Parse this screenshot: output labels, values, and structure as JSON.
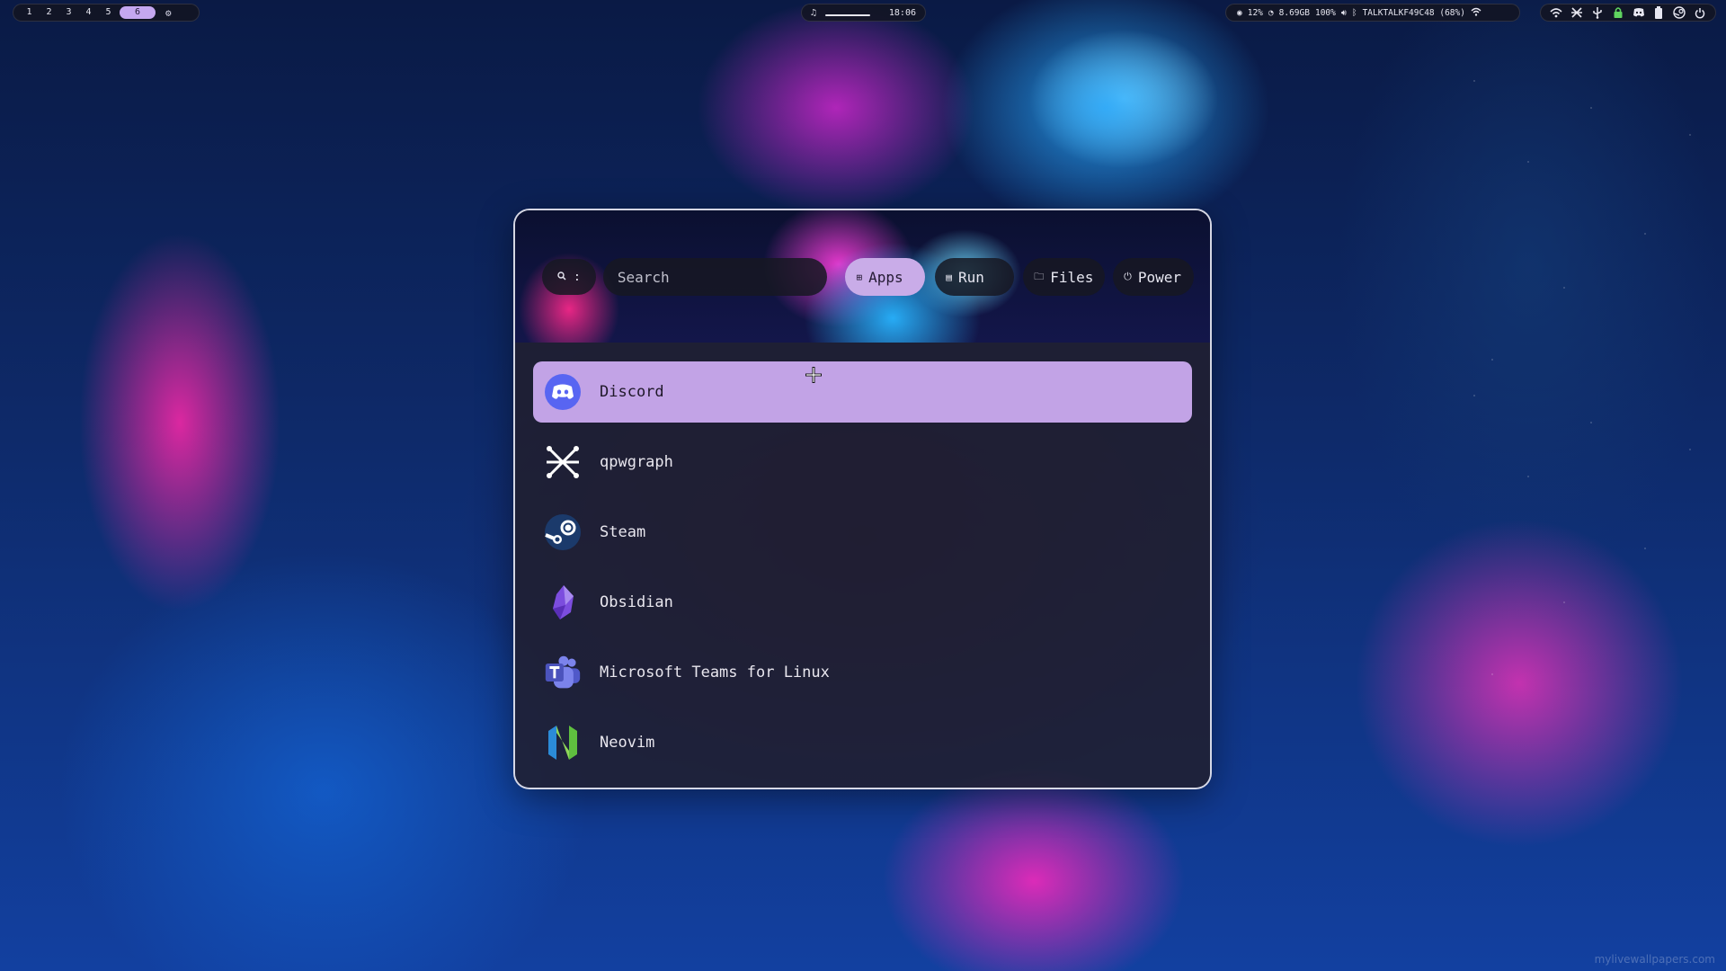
{
  "topbar": {
    "workspaces": [
      "1",
      "2",
      "3",
      "4",
      "5",
      "6"
    ],
    "active_workspace": "6",
    "settings_icon": "gear-icon",
    "center": {
      "icon": "music-icon",
      "clock": "18:06"
    },
    "stats": {
      "cpu": "12%",
      "memory": "8.69GB",
      "volume": "100%",
      "network": "TALKTALKF49C48 (68%)"
    },
    "tray_icons": [
      "wifi-icon",
      "qpwgraph-icon",
      "usb-icon",
      "lock-icon",
      "discord-icon",
      "battery-icon",
      "steam-icon",
      "power-icon"
    ]
  },
  "launcher": {
    "prefix": ":",
    "search_placeholder": "Search",
    "modes": {
      "apps": "Apps",
      "run": "Run",
      "files": "Files",
      "power": "Power"
    },
    "active_mode": "Apps",
    "apps": [
      {
        "label": "Discord",
        "icon": "discord-icon",
        "selected": true
      },
      {
        "label": "qpwgraph",
        "icon": "qpwgraph-icon",
        "selected": false
      },
      {
        "label": "Steam",
        "icon": "steam-icon",
        "selected": false
      },
      {
        "label": "Obsidian",
        "icon": "obsidian-icon",
        "selected": false
      },
      {
        "label": "Microsoft Teams for Linux",
        "icon": "teams-icon",
        "selected": false
      },
      {
        "label": "Neovim",
        "icon": "neovim-icon",
        "selected": false
      }
    ]
  },
  "watermark": "mylivewallpapers.com",
  "colors": {
    "accent": "#c4a7f0",
    "selected_row": "#c2a3e6",
    "panel": "#121422"
  }
}
